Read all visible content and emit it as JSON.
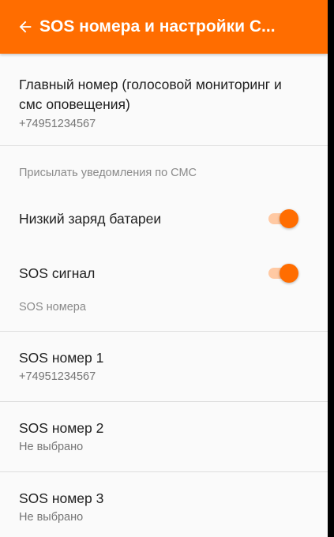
{
  "app_bar": {
    "title": "SOS номера и настройки С...",
    "back_icon": "arrow-left-icon",
    "color": "#ff6d00"
  },
  "main_number": {
    "title": "Главный номер (голосовой мониторинг и смс оповещения)",
    "value": "+74951234567"
  },
  "sms_category": {
    "label": "Присылать уведомления по СМС"
  },
  "toggles": [
    {
      "label": "Низкий заряд батареи",
      "checked": true
    },
    {
      "label": "SOS сигнал",
      "checked": true
    }
  ],
  "sos_category": {
    "label": "SOS номера"
  },
  "sos_numbers": [
    {
      "title": "SOS номер 1",
      "value": "+74951234567"
    },
    {
      "title": "SOS номер 2",
      "value": "Не выбрано"
    },
    {
      "title": "SOS номер 3",
      "value": "Не выбрано"
    }
  ]
}
